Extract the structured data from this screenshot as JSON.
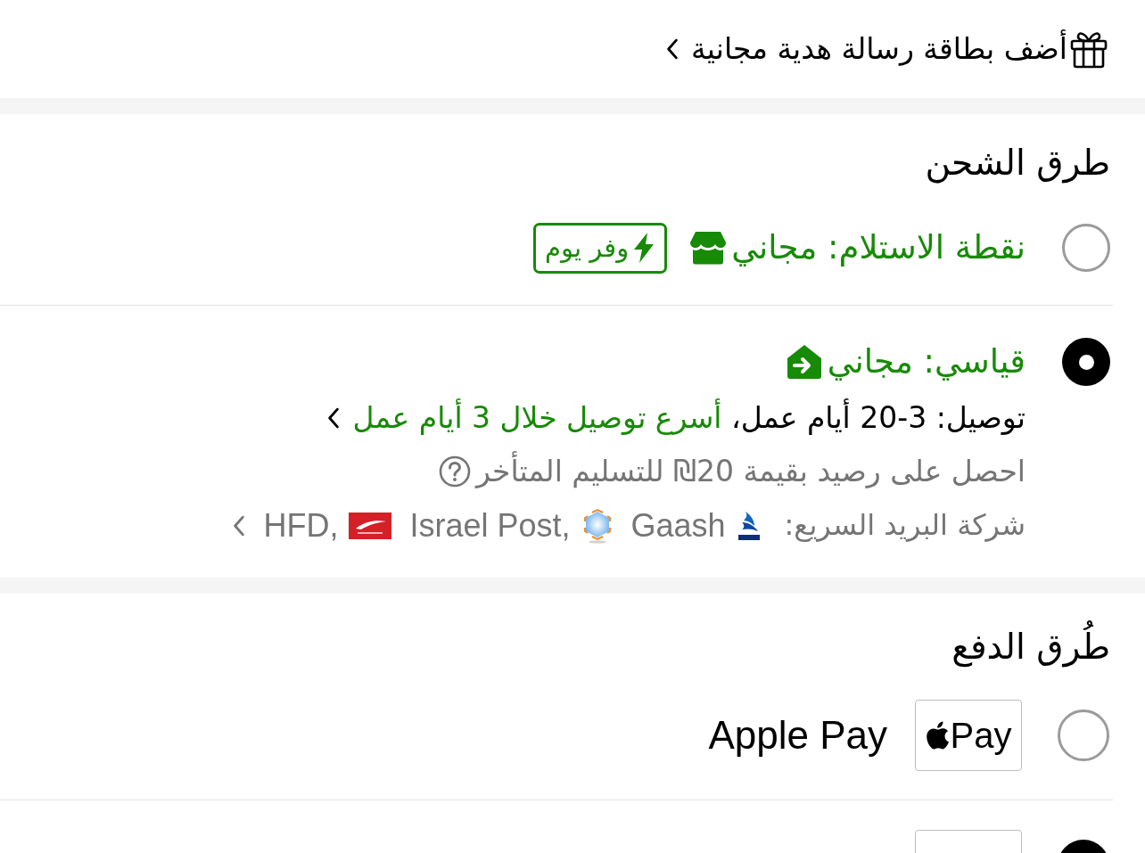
{
  "gift_card": {
    "label": "أضف بطاقة رسالة هدية مجانية"
  },
  "shipping": {
    "title": "طرق الشحن",
    "options": [
      {
        "kind": "pickup",
        "selected": false,
        "label": "نقطة الاستلام: مجاني",
        "badge": {
          "label": "وفر يوم"
        }
      },
      {
        "kind": "standard",
        "selected": true,
        "label": "قياسي: مجاني",
        "delivery": {
          "text": "توصيل: 3-20 أيام عمل، ",
          "link": "أسرع توصيل خلال 3 أيام عمل"
        },
        "note": "احصل على رصيد بقيمة 20₪ للتسليم المتأخر",
        "carriers": {
          "label": "شركة البريد السريع:",
          "parts": [
            {
              "kind": "swoosh_logo"
            },
            {
              "kind": "text",
              "text": "Gaash"
            },
            {
              "kind": "hex_logo"
            },
            {
              "kind": "text",
              "text": "Israel Post,"
            },
            {
              "kind": "flag_logo"
            },
            {
              "kind": "text",
              "text": "HFD,"
            }
          ]
        }
      }
    ]
  },
  "payment": {
    "title": "طُرق الدفع",
    "methods": [
      {
        "kind": "apple_pay",
        "selected": false,
        "label": "Apple Pay",
        "badge_text": "Pay"
      },
      {
        "kind": "card",
        "selected": true
      }
    ]
  }
}
